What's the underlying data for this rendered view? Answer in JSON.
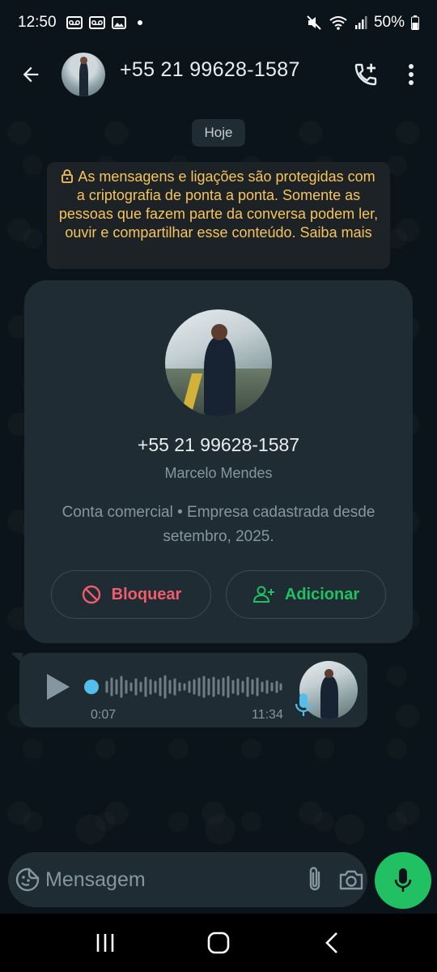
{
  "status_bar": {
    "time": "12:50",
    "battery": "50%",
    "icons": [
      "voicemail-icon",
      "voicemail-icon",
      "image-icon",
      "dot-icon",
      "mute-icon",
      "wifi-icon",
      "signal-icon",
      "battery-icon"
    ]
  },
  "header": {
    "title": "+55 21 99628-1587",
    "icons": [
      "back-arrow-icon",
      "add-call-icon",
      "more-vert-icon"
    ]
  },
  "chat": {
    "date_chip": "Hoje",
    "encryption_notice": "As mensagens e ligações são protegidas com a criptografia de ponta a ponta. Somente as pessoas que fazem parte da conversa podem ler, ouvir e compartilhar esse conteúdo. Saiba mais",
    "business_card": {
      "phone": "+55 21 99628-1587",
      "name": "Marcelo Mendes",
      "description": "Conta comercial • Empresa cadastrada desde setembro, 2025.",
      "block_label": "Bloquear",
      "add_label": "Adicionar"
    },
    "voice_message": {
      "elapsed": "0:07",
      "time": "11:34"
    }
  },
  "input": {
    "placeholder": "Mensagem"
  },
  "colors": {
    "background": "#0b141a",
    "bubble": "#1f2c33",
    "accent_green": "#21c063",
    "danger_red": "#f15c6d",
    "notice_yellow": "#f5c45b",
    "link_blue": "#53bdeb"
  }
}
